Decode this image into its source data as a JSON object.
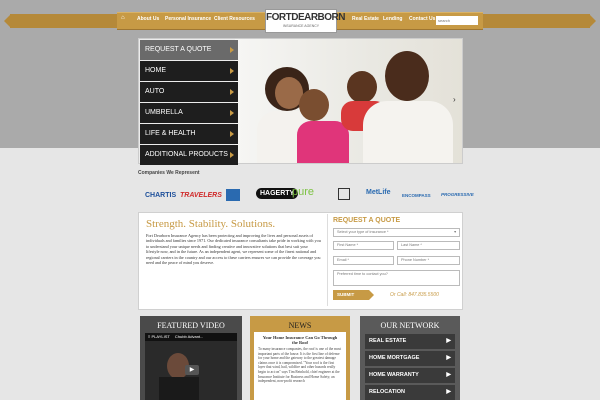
{
  "nav": {
    "items_left": [
      "About Us",
      "Personal Insurance",
      "Client Resources"
    ],
    "items_right": [
      "Real Estate",
      "Lending",
      "Contact Us"
    ],
    "logo_main": "FORTDEARBORN",
    "logo_sub": "INSURANCE AGENCY",
    "search_placeholder": "search"
  },
  "menu": {
    "items": [
      "REQUEST A QUOTE",
      "HOME",
      "AUTO",
      "UMBRELLA",
      "LIFE & HEALTH",
      "ADDITIONAL PRODUCTS"
    ]
  },
  "partners": {
    "title": "Companies We Represent",
    "logos": [
      "CHARTIS",
      "TRAVELERS",
      "HAGERTY",
      "pure",
      "MetLife",
      "ENCOMPASS",
      "PROGRESSIVE"
    ]
  },
  "about": {
    "tagline": "Strength. Stability. Solutions.",
    "body": "Fort Dearborn Insurance Agency has been protecting and improving the lives and personal assets of individuals and families since 1971. Our dedicated insurance consultants take pride in working with you to understand your unique needs and finding creative and innovative solutions that best suit your lifestyle now, and in the future. As an independent agent, we represent some of the finest national and regional carriers in the country and our access to these carriers ensures we can provide the coverage you need and the peace of mind you deserve."
  },
  "quote_form": {
    "title": "REQUEST A QUOTE",
    "select_placeholder": "Select your type of insurance *",
    "first_name": "First Name *",
    "last_name": "Last Name *",
    "email": "Email *",
    "phone": "Phone Number *",
    "preferred_time": "Preferred time to contact you?",
    "submit": "SUBMIT",
    "call": "Or Call: 847.835.5500"
  },
  "video": {
    "title": "FEATURED VIDEO",
    "playlist_label": "PLAYLIST",
    "video_title": "Chubb Advant..."
  },
  "news": {
    "title": "NEWS",
    "headline": "Your Home Insurance Can Go Through the Roof",
    "body": "To many insurance companies, the roof is one of the most important parts of the house. It is the first line of defense for your home and the gateway to the greatest damage claims once it is compromised. \"Your roof is the first layer that wind, hail, wildfire and other hazards really begin to act on\" says Tim Reinhold, chief engineer at the Insurance Institute for Business and Home Safety; an independent, non-profit research"
  },
  "network": {
    "title": "OUR NETWORK",
    "items": [
      "REAL ESTATE",
      "HOME MORTGAGE",
      "HOME WARRANTY",
      "RELOCATION"
    ]
  },
  "colors": {
    "gold": "#c79a45",
    "dark": "#1e1e1e",
    "gray_top": "#aaaaaa"
  }
}
